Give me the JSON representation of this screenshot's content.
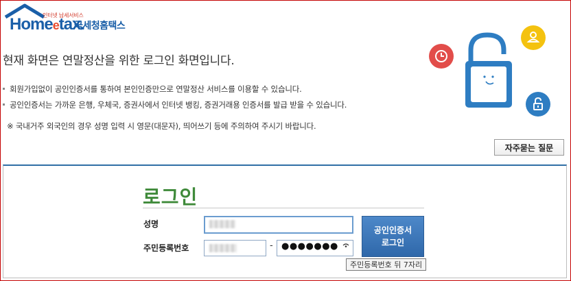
{
  "logo": {
    "tagline": "인터넷 납세서비스",
    "brand_main": "Home",
    "brand_e": "e",
    "brand_tail": "tax.",
    "brand_korean": "국세청홈택스"
  },
  "headline": "현재 화면은 연말정산을 위한 로그인 화면입니다.",
  "bullets": [
    "회원가입없이 공인인증서를 통하여 본인인증만으로 연말정산 서비스를 이용할 수 있습니다.",
    "공인인증서는 가까운 은행, 우체국, 증권사에서 인터넷 뱅킹, 증권거래용 인증서를 발급 받을 수 있습니다."
  ],
  "note": "※ 국내거주 외국인의 경우 성명 입력 시 영문(대문자), 띄어쓰기 등에 주의하여 주시기 바랍니다.",
  "faq_label": "자주묻는 질문",
  "login": {
    "title": "로그인",
    "name_label": "성명",
    "rrn_label": "주민등록번호",
    "rrn_separator": "-",
    "rrn_masked": "●●●●●●●",
    "cert_button_line1": "공인인증서",
    "cert_button_line2": "로그인",
    "tooltip": "주민등록번호 뒤 7자리"
  },
  "colors": {
    "brand_blue": "#1a5fa8",
    "accent_red": "#e24d4a",
    "accent_yellow": "#f4c20f",
    "accent_blue": "#2e7dc2",
    "title_green": "#3f8a3a"
  },
  "icons": [
    "clock-icon",
    "user-icon",
    "lock-icon",
    "padlock-illustration",
    "eye-icon"
  ]
}
